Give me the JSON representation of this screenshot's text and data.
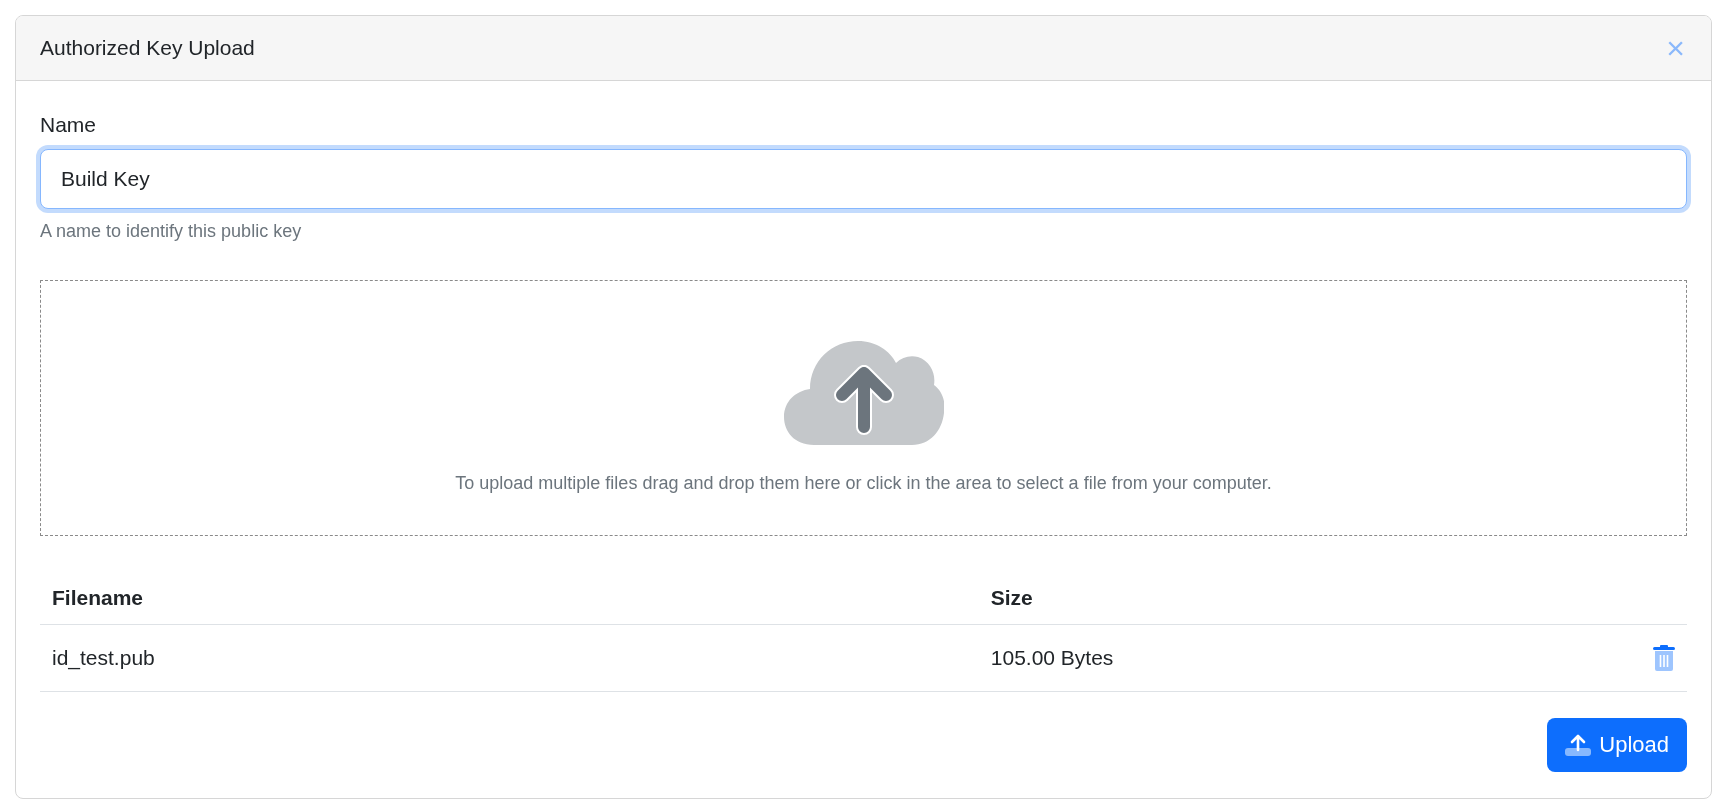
{
  "dialog": {
    "title": "Authorized Key Upload",
    "close_label": "×"
  },
  "name_field": {
    "label": "Name",
    "value": "Build Key",
    "focused": true,
    "help": "A name to identify this public key"
  },
  "dropzone": {
    "text": "To upload multiple files drag and drop them here or click in the area to select a file from your computer."
  },
  "table": {
    "columns": [
      "Filename",
      "Size"
    ],
    "rows": [
      {
        "filename": "id_test.pub",
        "size": "105.00 Bytes"
      }
    ]
  },
  "upload_button": {
    "label": "Upload"
  }
}
